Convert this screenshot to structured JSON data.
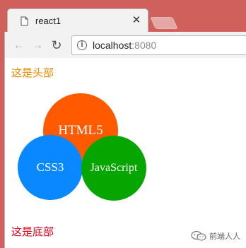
{
  "browser": {
    "tab_title": "react1",
    "tab_close_icon": "✕",
    "url_host": "localhost",
    "url_port": ":8080",
    "back_icon": "←",
    "forward_icon": "→",
    "reload_icon": "↻",
    "info_icon": "i"
  },
  "page": {
    "header_text": "这是头部",
    "circles": {
      "html5": "HTML5",
      "css3": "CSS3",
      "javascript": "JavaScript"
    },
    "footer_text": "这是底部",
    "watermark_text": "前端人人"
  },
  "colors": {
    "header": "#f08a00",
    "html5": "#ff5a00",
    "css3": "#0a88ff",
    "javascript": "#07a500",
    "footer": "#e0001a",
    "window_frame": "#d0605c"
  }
}
